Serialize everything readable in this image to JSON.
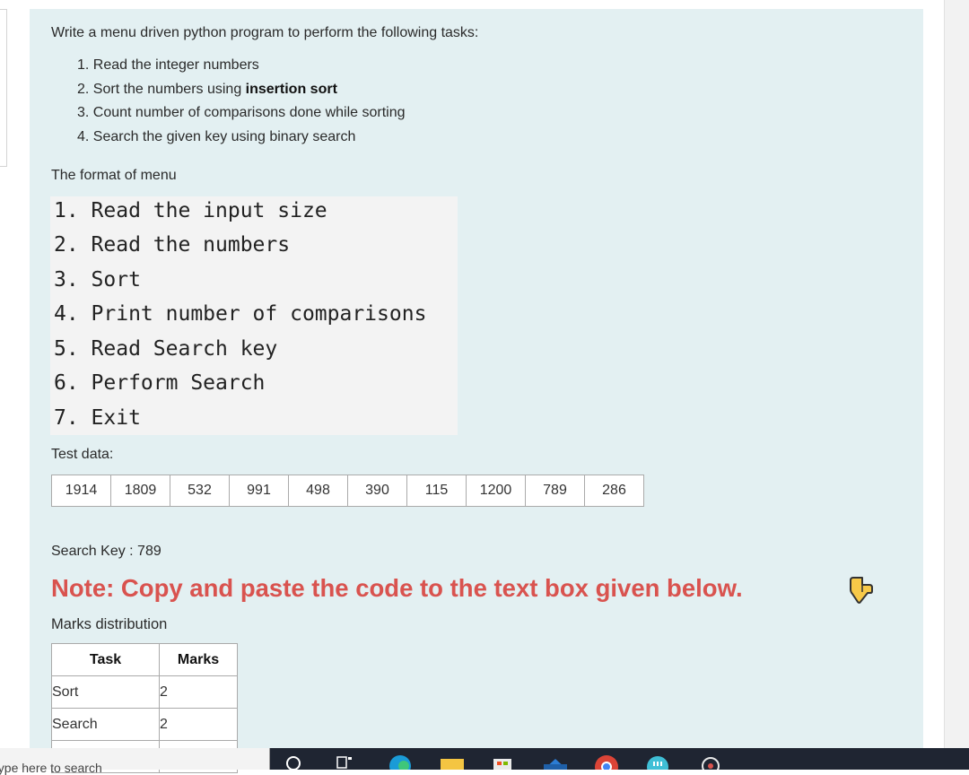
{
  "question": {
    "prompt": "Write a menu driven python  program to perform the following tasks:",
    "tasks": [
      {
        "text": "1. Read the integer numbers",
        "bold": ""
      },
      {
        "text": "2. Sort the numbers using ",
        "bold": "insertion sort"
      },
      {
        "text": "3. Count number of comparisons done  while sorting",
        "bold": ""
      },
      {
        "text": "4. Search the given  key using binary search",
        "bold": ""
      }
    ]
  },
  "menu": {
    "title": "The format  of menu",
    "items": [
      "1. Read the input size",
      "2. Read the numbers",
      "3. Sort",
      "4. Print number of comparisons",
      "5. Read Search key",
      "6. Perform Search",
      "7. Exit"
    ]
  },
  "test_data": {
    "title": "Test  data:",
    "values": [
      "1914",
      "1809",
      "532",
      "991",
      "498",
      "390",
      "115",
      "1200",
      "789",
      "286"
    ]
  },
  "search_key": "Search Key : 789",
  "note": "Note:  Copy and paste the code to  the text box given below.",
  "marks": {
    "title": "Marks distribution",
    "headers": [
      "Task",
      "Marks"
    ],
    "rows": [
      {
        "task": "Sort",
        "marks": "2"
      },
      {
        "task": "Search",
        "marks": "2"
      }
    ]
  },
  "taskbar": {
    "search_placeholder": "Type here to search",
    "icons": [
      "cortana-icon",
      "task-view-icon",
      "edge-icon",
      "file-explorer-icon",
      "store-icon",
      "mail-icon",
      "chrome-icon",
      "app-icon",
      "settings-icon"
    ]
  },
  "colors": {
    "panel_bg": "#e3f0f2",
    "note": "#d9534f",
    "menu_bg": "#f3f3f3",
    "taskbar": "#1f2532"
  }
}
